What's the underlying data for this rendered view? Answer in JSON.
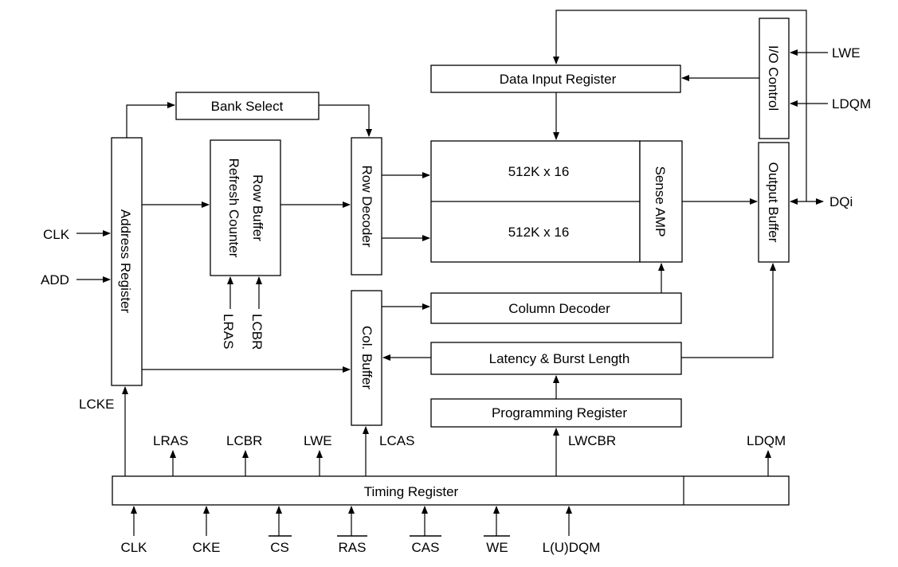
{
  "blocks": {
    "bank_select": "Bank Select",
    "address_register": "Address Register",
    "row_buffer_line1": "Row Buffer",
    "row_buffer_line2": "Refresh Counter",
    "row_decoder": "Row Decoder",
    "col_buffer": "Col. Buffer",
    "data_input_register": "Data Input Register",
    "array_top": "512K x 16",
    "array_bottom": "512K x 16",
    "sense_amp": "Sense AMP",
    "io_control": "I/O Control",
    "output_buffer": "Output Buffer",
    "column_decoder": "Column Decoder",
    "latency_burst": "Latency & Burst Length",
    "programming_register": "Programming Register",
    "timing_register": "Timing Register"
  },
  "signals": {
    "clk_left": "CLK",
    "add_left": "ADD",
    "lcke": "LCKE",
    "lras_rb": "LRAS",
    "lcbr_rb": "LCBR",
    "lwe_right": "LWE",
    "ldqm_right": "LDQM",
    "dqi": "DQi",
    "out_lras": "LRAS",
    "out_lcbr": "LCBR",
    "out_lwe": "LWE",
    "out_lcas": "LCAS",
    "out_lwcbr": "LWCBR",
    "out_ldqm": "LDQM",
    "in_clk": "CLK",
    "in_cke": "CKE",
    "in_cs": "CS",
    "in_ras": "RAS",
    "in_cas": "CAS",
    "in_we": "WE",
    "in_ludqm": "L(U)DQM"
  },
  "active_low_inputs": [
    "CS",
    "RAS",
    "CAS",
    "WE"
  ]
}
